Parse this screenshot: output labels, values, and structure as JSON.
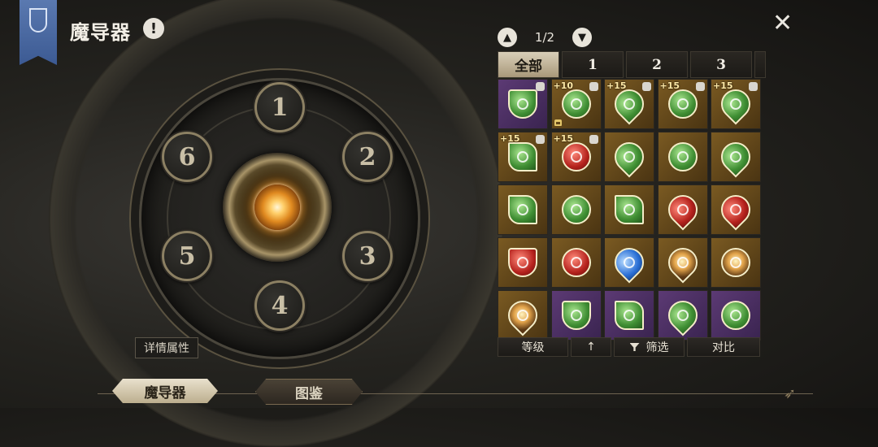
{
  "header": {
    "title": "魔导器",
    "info_icon": "!",
    "close_icon": "✕"
  },
  "dial": {
    "slots": [
      "1",
      "2",
      "3",
      "4",
      "5",
      "6"
    ]
  },
  "detail_button": "详情属性",
  "bottom_tabs": [
    {
      "label": "魔导器",
      "active": true
    },
    {
      "label": "图鉴",
      "active": false
    }
  ],
  "panel": {
    "pager": {
      "text": "1/2",
      "up_icon": "chevron-up-icon",
      "down_icon": "chevron-down-icon"
    },
    "tabs": [
      {
        "label": "全部",
        "active": true
      },
      {
        "label": "1"
      },
      {
        "label": "2"
      },
      {
        "label": "3"
      }
    ],
    "items": [
      {
        "bg": "purple",
        "color": "green",
        "shape": "shield",
        "level": "",
        "equipped": true,
        "locked": false
      },
      {
        "bg": "gold",
        "color": "green",
        "shape": "round",
        "level": "+10",
        "equipped": true,
        "locked": true
      },
      {
        "bg": "gold",
        "color": "green",
        "shape": "drop",
        "level": "+15",
        "equipped": true,
        "locked": false
      },
      {
        "bg": "gold",
        "color": "green",
        "shape": "round",
        "level": "+15",
        "equipped": true,
        "locked": false
      },
      {
        "bg": "gold",
        "color": "green",
        "shape": "drop",
        "level": "+15",
        "equipped": true,
        "locked": false
      },
      {
        "bg": "gold",
        "color": "green",
        "shape": "flag",
        "level": "+15",
        "equipped": true,
        "locked": false
      },
      {
        "bg": "gold",
        "color": "red",
        "shape": "round",
        "level": "+15",
        "equipped": true,
        "locked": false
      },
      {
        "bg": "gold",
        "color": "green",
        "shape": "drop",
        "level": "",
        "equipped": false,
        "locked": false
      },
      {
        "bg": "gold",
        "color": "green",
        "shape": "round",
        "level": "",
        "equipped": false,
        "locked": false
      },
      {
        "bg": "gold",
        "color": "green",
        "shape": "drop",
        "level": "",
        "equipped": false,
        "locked": false
      },
      {
        "bg": "gold",
        "color": "green",
        "shape": "flag",
        "level": "",
        "equipped": false,
        "locked": false
      },
      {
        "bg": "gold",
        "color": "green",
        "shape": "round",
        "level": "",
        "equipped": false,
        "locked": false
      },
      {
        "bg": "gold",
        "color": "green",
        "shape": "flag",
        "level": "",
        "equipped": false,
        "locked": false
      },
      {
        "bg": "gold",
        "color": "red",
        "shape": "drop",
        "level": "",
        "equipped": false,
        "locked": false
      },
      {
        "bg": "gold",
        "color": "red",
        "shape": "drop",
        "level": "",
        "equipped": false,
        "locked": false
      },
      {
        "bg": "gold",
        "color": "red",
        "shape": "shield",
        "level": "",
        "equipped": false,
        "locked": false
      },
      {
        "bg": "gold",
        "color": "red",
        "shape": "round",
        "level": "",
        "equipped": false,
        "locked": false
      },
      {
        "bg": "gold",
        "color": "blue",
        "shape": "drop",
        "level": "",
        "equipped": false,
        "locked": false
      },
      {
        "bg": "gold",
        "color": "lantern",
        "shape": "drop",
        "level": "",
        "equipped": false,
        "locked": false
      },
      {
        "bg": "gold",
        "color": "lantern",
        "shape": "round",
        "level": "",
        "equipped": false,
        "locked": false
      },
      {
        "bg": "gold",
        "color": "lantern",
        "shape": "drop",
        "level": "",
        "equipped": false,
        "locked": false
      },
      {
        "bg": "purple",
        "color": "green",
        "shape": "shield",
        "level": "",
        "equipped": false,
        "locked": false
      },
      {
        "bg": "purple",
        "color": "green",
        "shape": "flag",
        "level": "",
        "equipped": false,
        "locked": false
      },
      {
        "bg": "purple",
        "color": "green",
        "shape": "drop",
        "level": "",
        "equipped": false,
        "locked": false
      },
      {
        "bg": "purple",
        "color": "green",
        "shape": "round",
        "level": "",
        "equipped": false,
        "locked": false
      }
    ],
    "bottom_bar": {
      "level": "等级",
      "sort_icon": "↑",
      "filter": "筛选",
      "compare": "对比"
    }
  },
  "colors": {
    "accent_gold": "#c9b27a",
    "banner_blue": "#4a69a3",
    "item_purple": "#4a2f62",
    "item_gold": "#6a4c1c"
  }
}
